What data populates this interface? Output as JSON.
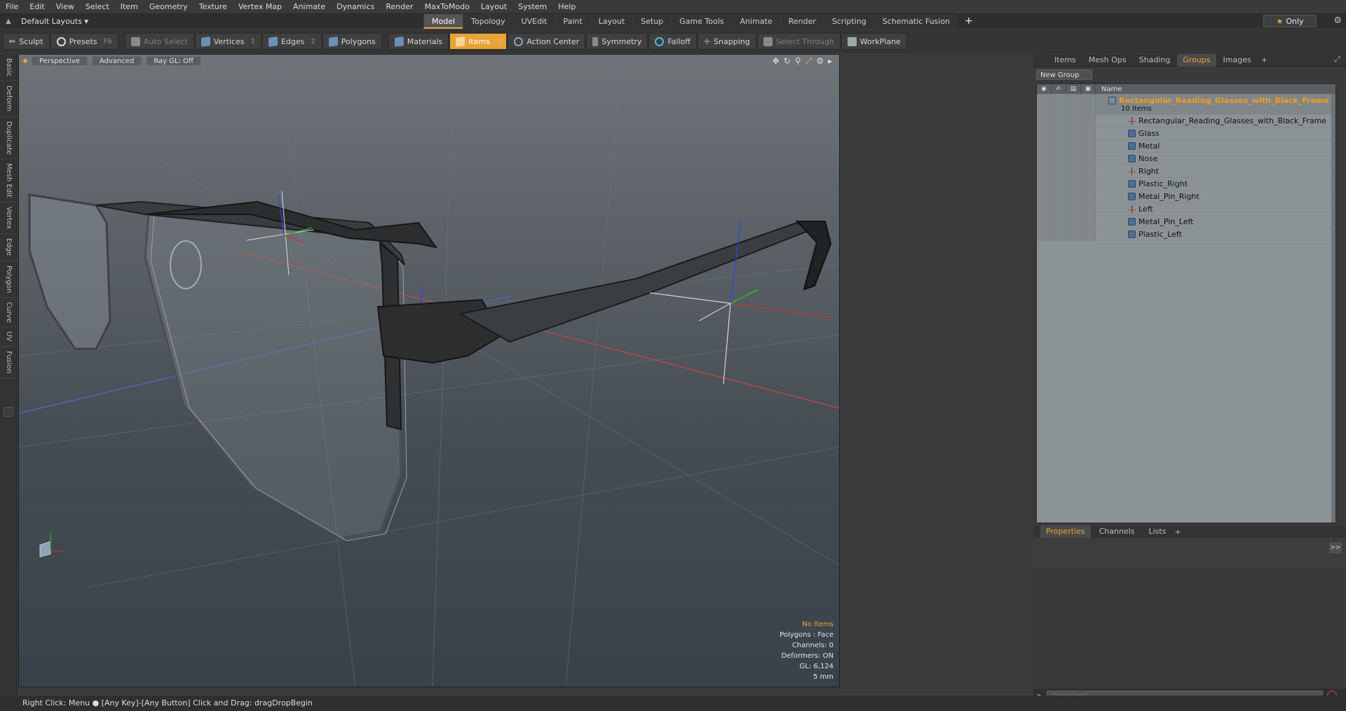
{
  "menu": [
    "File",
    "Edit",
    "View",
    "Select",
    "Item",
    "Geometry",
    "Texture",
    "Vertex Map",
    "Animate",
    "Dynamics",
    "Render",
    "MaxToModo",
    "Layout",
    "System",
    "Help"
  ],
  "layout": {
    "default_label": "Default Layouts"
  },
  "tabs": [
    "Model",
    "Topology",
    "UVEdit",
    "Paint",
    "Layout",
    "Setup",
    "Game Tools",
    "Animate",
    "Render",
    "Scripting",
    "Schematic Fusion"
  ],
  "active_tab": "Model",
  "only_label": "Only",
  "toolbar": {
    "sculpt": "Sculpt",
    "presets": "Presets",
    "presets_key": "F6",
    "auto_select": "Auto Select",
    "vertices": "Vertices",
    "vertices_key": "1",
    "edges": "Edges",
    "edges_key": "2",
    "polygons": "Polygons",
    "materials": "Materials",
    "items": "Items",
    "items_key": "5",
    "action_center": "Action Center",
    "symmetry": "Symmetry",
    "falloff": "Falloff",
    "snapping": "Snapping",
    "select_through": "Select Through",
    "workplane": "WorkPlane"
  },
  "left_tabs": [
    "Basic",
    "Deform",
    "Duplicate",
    "Mesh Edit",
    "Vertex",
    "Edge",
    "Polygon",
    "Curve",
    "UV",
    "Fusion"
  ],
  "viewport": {
    "perspective": "Perspective",
    "advanced": "Advanced",
    "raygl": "Ray GL: Off",
    "stats": {
      "no_items": "No Items",
      "polygons": "Polygons : Face",
      "channels": "Channels: 0",
      "deformers": "Deformers: ON",
      "gl": "GL: 6,124",
      "unit": "5 mm"
    }
  },
  "status": "Right Click: Menu ●  [Any Key]-[Any Button] Click and Drag: dragDropBegin",
  "right_panel": {
    "tabs": [
      "Items",
      "Mesh Ops",
      "Shading",
      "Groups",
      "Images"
    ],
    "active_tab": "Groups",
    "new_group": "New Group",
    "name_header": "Name",
    "group_name": "Rectangular_Reading_Glasses_with_Black_Frame",
    "group_count": "10 Items",
    "items": [
      {
        "name": "Rectangular_Reading_Glasses_with_Black_Frame",
        "icon": "locator-icon"
      },
      {
        "name": "Glass",
        "icon": "mesh-icon"
      },
      {
        "name": "Metal",
        "icon": "mesh-icon"
      },
      {
        "name": "Nose",
        "icon": "mesh-icon"
      },
      {
        "name": "Right",
        "icon": "locator-icon"
      },
      {
        "name": "Plastic_Right",
        "icon": "mesh-icon"
      },
      {
        "name": "Metal_Pin_Right",
        "icon": "mesh-icon"
      },
      {
        "name": "Left",
        "icon": "locator-icon"
      },
      {
        "name": "Metal_Pin_Left",
        "icon": "mesh-icon"
      },
      {
        "name": "Plastic_Left",
        "icon": "mesh-icon"
      }
    ],
    "bottom_tabs": [
      "Properties",
      "Channels",
      "Lists"
    ],
    "bottom_active": "Properties",
    "command_placeholder": "Command"
  },
  "colors": {
    "accent": "#e8a33a",
    "group_title": "#f39b1e"
  }
}
